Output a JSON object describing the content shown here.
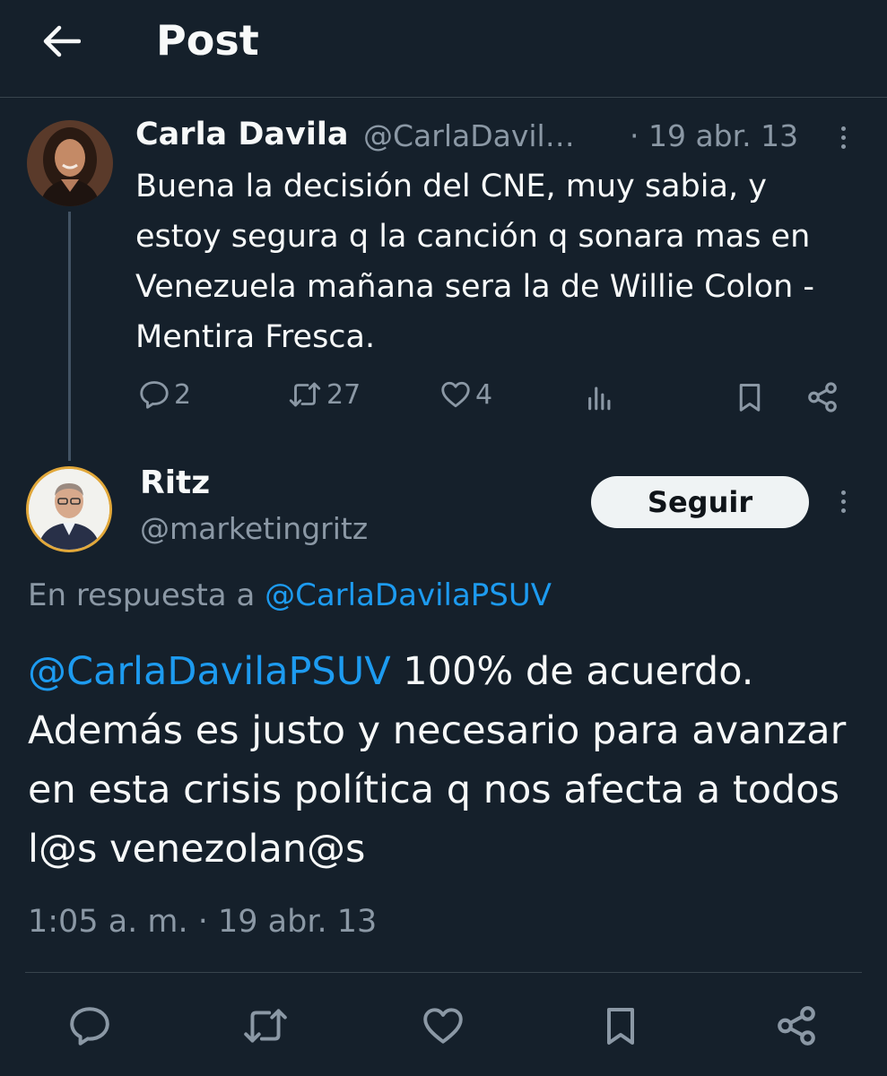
{
  "header": {
    "title": "Post"
  },
  "parent_tweet": {
    "name": "Carla Davila",
    "handle": "@CarlaDavil…",
    "date": "· 19 abr. 13",
    "text": "Buena la decisión del CNE, muy sabia, y estoy segura q la canción q sonara mas en Venezuela mañana sera la de Willie Colon - Mentira Fresca.",
    "reply_count": "2",
    "retweet_count": "27",
    "like_count": "4"
  },
  "reply_tweet": {
    "name": "Ritz",
    "handle": "@marketingritz",
    "follow_label": "Seguir",
    "reply_to_label": "En respuesta a",
    "reply_to_mention": "@CarlaDavilaPSUV",
    "text_mention": "@CarlaDavilaPSUV",
    "text": " 100% de acuerdo. Además es justo y necesario para avanzar en esta crisis política q nos afecta a todos l@s venezolan@s",
    "timestamp": "1:05 a. m. · 19 abr. 13"
  },
  "colors": {
    "background": "#15202b",
    "accent": "#1d9bf0",
    "muted": "#8b98a5",
    "text": "#f7f9f9"
  },
  "icons": [
    "arrow-left-icon",
    "reply-icon",
    "retweet-icon",
    "like-icon",
    "views-icon",
    "bookmark-icon",
    "share-icon",
    "more-icon"
  ]
}
